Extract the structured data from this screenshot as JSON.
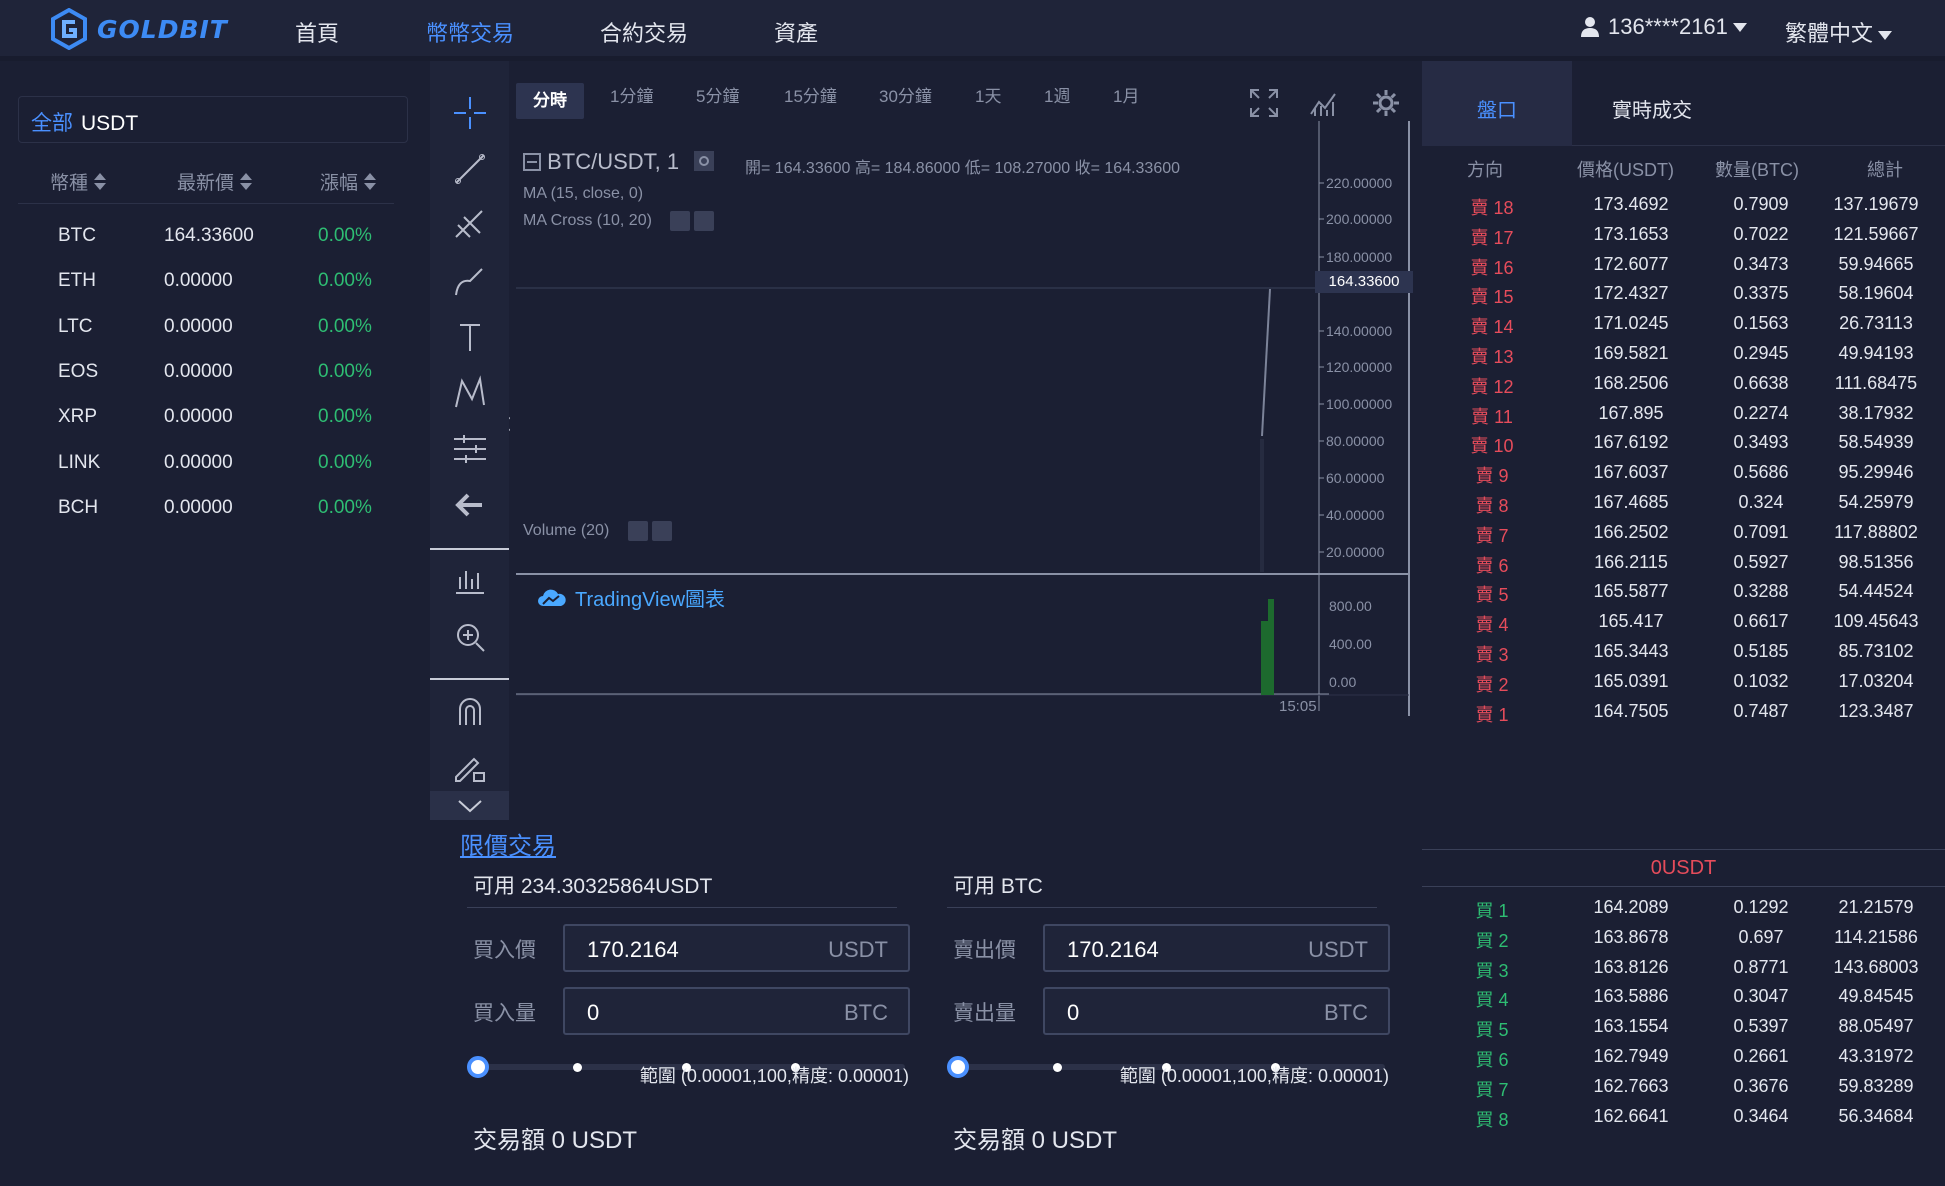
{
  "app": {
    "logo_text": "GOLDBIT"
  },
  "nav": {
    "items": [
      "首頁",
      "幣幣交易",
      "合約交易",
      "資產"
    ],
    "active_index": 1,
    "user": "136****2161",
    "language": "繁體中文"
  },
  "market": {
    "tab_all": "全部",
    "tab_quote": "USDT",
    "columns": [
      "幣種",
      "最新價",
      "漲幅"
    ],
    "rows": [
      {
        "coin": "BTC",
        "price": "164.33600",
        "change": "0.00%"
      },
      {
        "coin": "ETH",
        "price": "0.00000",
        "change": "0.00%"
      },
      {
        "coin": "LTC",
        "price": "0.00000",
        "change": "0.00%"
      },
      {
        "coin": "EOS",
        "price": "0.00000",
        "change": "0.00%"
      },
      {
        "coin": "XRP",
        "price": "0.00000",
        "change": "0.00%"
      },
      {
        "coin": "LINK",
        "price": "0.00000",
        "change": "0.00%"
      },
      {
        "coin": "BCH",
        "price": "0.00000",
        "change": "0.00%"
      }
    ]
  },
  "chart": {
    "intervals": [
      "分時",
      "1分鐘",
      "5分鐘",
      "15分鐘",
      "30分鐘",
      "1天",
      "1週",
      "1月"
    ],
    "active_interval": "分時",
    "symbol": "BTC/USDT, 1",
    "ohlc": "開= 164.33600  高= 184.86000  低= 108.27000  收= 164.33600",
    "indicators": [
      "MA (15, close, 0)",
      "MA Cross (10, 20)"
    ],
    "volume_label": "Volume (20)",
    "last_price": "164.33600",
    "watermark": "TradingView圖表",
    "time_label": "15:05",
    "price_axis": [
      "220.00000",
      "200.00000",
      "180.00000",
      "140.00000",
      "120.00000",
      "100.00000",
      "80.00000",
      "60.00000",
      "40.00000",
      "20.00000"
    ],
    "volume_axis": [
      "800.00",
      "400.00",
      "0.00"
    ]
  },
  "orderbook": {
    "tabs": [
      "盤口",
      "實時成交"
    ],
    "columns": [
      "方向",
      "價格(USDT)",
      "數量(BTC)",
      "總計"
    ],
    "asks": [
      [
        "賣 18",
        "173.4692",
        "0.7909",
        "137.19679"
      ],
      [
        "賣 17",
        "173.1653",
        "0.7022",
        "121.59667"
      ],
      [
        "賣 16",
        "172.6077",
        "0.3473",
        "59.94665"
      ],
      [
        "賣 15",
        "172.4327",
        "0.3375",
        "58.19604"
      ],
      [
        "賣 14",
        "171.0245",
        "0.1563",
        "26.73113"
      ],
      [
        "賣 13",
        "169.5821",
        "0.2945",
        "49.94193"
      ],
      [
        "賣 12",
        "168.2506",
        "0.6638",
        "111.68475"
      ],
      [
        "賣 11",
        "167.895",
        "0.2274",
        "38.17932"
      ],
      [
        "賣 10",
        "167.6192",
        "0.3493",
        "58.54939"
      ],
      [
        "賣 9",
        "167.6037",
        "0.5686",
        "95.29946"
      ],
      [
        "賣 8",
        "167.4685",
        "0.324",
        "54.25979"
      ],
      [
        "賣 7",
        "166.2502",
        "0.7091",
        "117.88802"
      ],
      [
        "賣 6",
        "166.2115",
        "0.5927",
        "98.51356"
      ],
      [
        "賣 5",
        "165.5877",
        "0.3288",
        "54.44524"
      ],
      [
        "賣 4",
        "165.417",
        "0.6617",
        "109.45643"
      ],
      [
        "賣 3",
        "165.3443",
        "0.5185",
        "85.73102"
      ],
      [
        "賣 2",
        "165.0391",
        "0.1032",
        "17.03204"
      ],
      [
        "賣 1",
        "164.7505",
        "0.7487",
        "123.3487"
      ]
    ],
    "mid_price": "0USDT",
    "bids": [
      [
        "買 1",
        "164.2089",
        "0.1292",
        "21.21579"
      ],
      [
        "買 2",
        "163.8678",
        "0.697",
        "114.21586"
      ],
      [
        "買 3",
        "163.8126",
        "0.8771",
        "143.68003"
      ],
      [
        "買 4",
        "163.5886",
        "0.3047",
        "49.84545"
      ],
      [
        "買 5",
        "163.1554",
        "0.5397",
        "88.05497"
      ],
      [
        "買 6",
        "162.7949",
        "0.2661",
        "43.31972"
      ],
      [
        "買 7",
        "162.7663",
        "0.3676",
        "59.83289"
      ],
      [
        "買 8",
        "162.6641",
        "0.3464",
        "56.34684"
      ]
    ]
  },
  "trade": {
    "title": "限價交易",
    "buy": {
      "available": "可用 234.30325864USDT",
      "price_label": "買入價",
      "price_value": "170.2164",
      "price_unit": "USDT",
      "qty_label": "買入量",
      "qty_value": "0",
      "qty_unit": "BTC",
      "range": "範圍 (0.00001,100,精度: 0.00001)",
      "amount": "交易額 0 USDT"
    },
    "sell": {
      "available": "可用 BTC",
      "price_label": "賣出價",
      "price_value": "170.2164",
      "price_unit": "USDT",
      "qty_label": "賣出量",
      "qty_value": "0",
      "qty_unit": "BTC",
      "range": "範圍 (0.00001,100,精度: 0.00001)",
      "amount": "交易額 0 USDT"
    }
  },
  "colors": {
    "accent": "#4a90ff",
    "up": "#2ebd73",
    "down": "#e64c5b",
    "bg": "#1b1f33"
  }
}
